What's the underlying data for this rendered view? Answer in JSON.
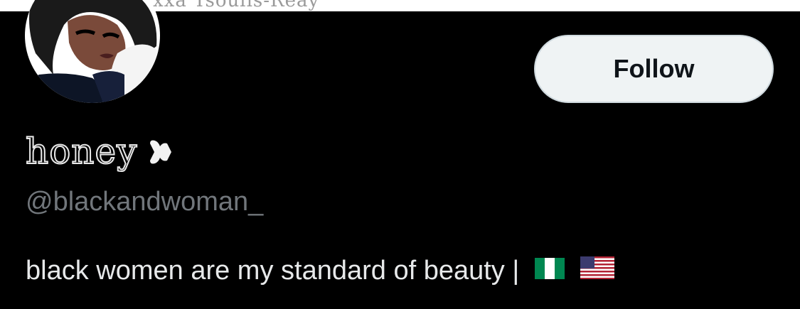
{
  "banner": {
    "text": "xxa Tsoulis-Reay"
  },
  "profile": {
    "display_name": "honey",
    "username": "@blackandwoman_",
    "bio": "black women are my standard of beauty |",
    "bio_flags": [
      "nigeria-flag-icon",
      "usa-flag-icon"
    ]
  },
  "actions": {
    "follow_label": "Follow"
  },
  "colors": {
    "background": "#000000",
    "follow_bg": "#eff3f4",
    "follow_text": "#0f1419",
    "muted_text": "#71767b",
    "body_text": "#e7e9ea"
  }
}
